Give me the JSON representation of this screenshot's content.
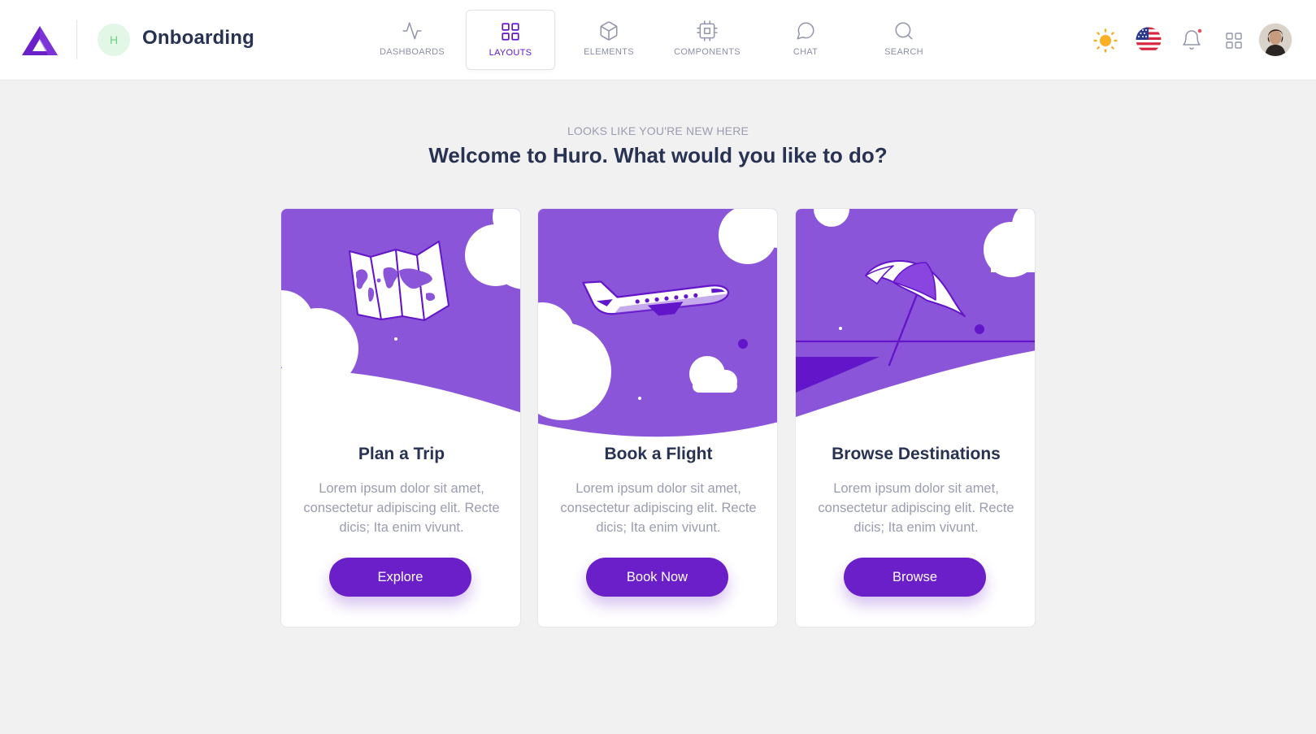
{
  "header": {
    "page_avatar_letter": "H",
    "page_title": "Onboarding",
    "nav": [
      {
        "label": "DASHBOARDS",
        "icon": "activity-icon",
        "active": false
      },
      {
        "label": "LAYOUTS",
        "icon": "grid-icon",
        "active": true
      },
      {
        "label": "ELEMENTS",
        "icon": "box-icon",
        "active": false
      },
      {
        "label": "COMPONENTS",
        "icon": "cpu-icon",
        "active": false
      },
      {
        "label": "CHAT",
        "icon": "message-circle-icon",
        "active": false
      },
      {
        "label": "SEARCH",
        "icon": "search-icon",
        "active": false
      }
    ],
    "tools": [
      "sun-icon",
      "us-flag-icon",
      "bell-icon",
      "apps-grid-icon",
      "user-avatar"
    ]
  },
  "hero": {
    "subtitle": "LOOKS LIKE YOU'RE NEW HERE",
    "headline": "Welcome to Huro. What would you like to do?"
  },
  "cards": [
    {
      "title": "Plan a Trip",
      "text": "Lorem ipsum dolor sit amet, consectetur adipiscing elit. Recte dicis; Ita enim vivunt.",
      "button": "Explore",
      "illustration": "folded-map-illustration"
    },
    {
      "title": "Book a Flight",
      "text": "Lorem ipsum dolor sit amet, consectetur adipiscing elit. Recte dicis; Ita enim vivunt.",
      "button": "Book Now",
      "illustration": "airplane-illustration"
    },
    {
      "title": "Browse Destinations",
      "text": "Lorem ipsum dolor sit amet, consectetur adipiscing elit. Recte dicis; Ita enim vivunt.",
      "button": "Browse",
      "illustration": "beach-umbrella-illustration"
    }
  ],
  "colors": {
    "primary": "#6a1fc9",
    "illustration_purple": "#8b55d9",
    "heading": "#283252",
    "muted": "#9a9cb0",
    "background": "#f1f1f1",
    "notification_dot": "#e8505b",
    "sun": "#f9b023"
  }
}
